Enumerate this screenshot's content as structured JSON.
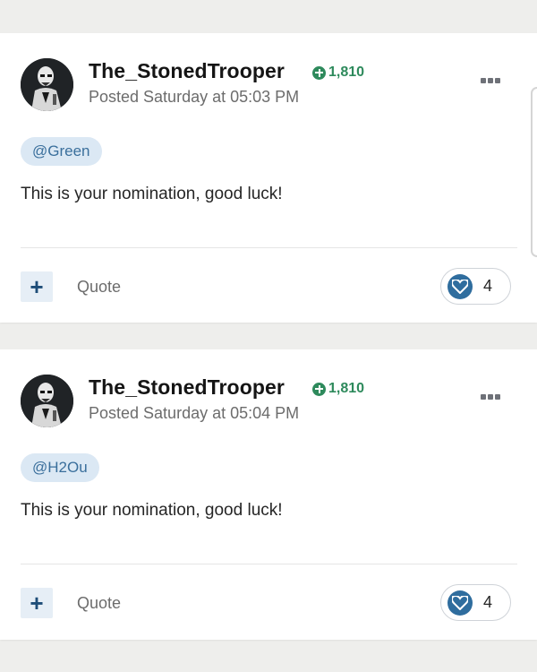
{
  "posts": [
    {
      "username": "The_StonedTrooper",
      "reputation": "1,810",
      "posted": "Posted Saturday at 05:03 PM",
      "mention": "@Green",
      "content": "This is your nomination, good luck!",
      "quote_label": "Quote",
      "reaction_count": "4"
    },
    {
      "username": "The_StonedTrooper",
      "reputation": "1,810",
      "posted": "Posted Saturday at 05:04 PM",
      "mention": "@H2Ou",
      "content": "This is your nomination, good luck!",
      "quote_label": "Quote",
      "reaction_count": "4"
    }
  ],
  "colors": {
    "reputation": "#2e8a5c",
    "mention_bg": "#dbe8f4",
    "mention_text": "#3a6f9c",
    "reaction": "#2f6d9e"
  },
  "icons": {
    "reputation": "plus-circle-icon",
    "more": "ellipsis-icon",
    "multiquote": "plus-icon",
    "reaction": "heart-icon"
  }
}
